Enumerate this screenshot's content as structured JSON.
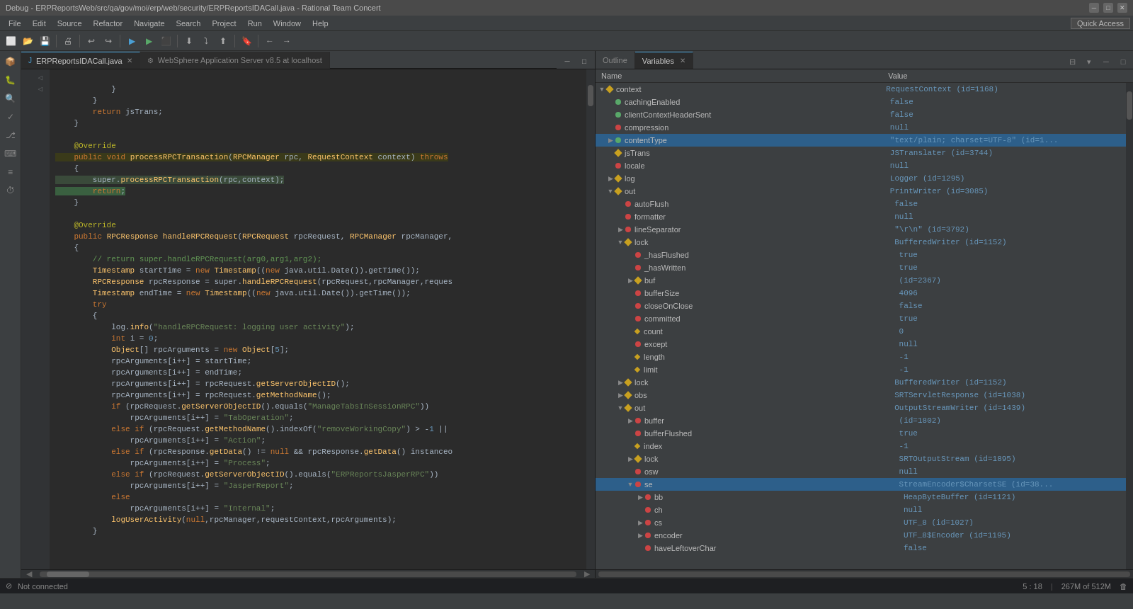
{
  "titleBar": {
    "title": "Debug - ERPReportsWeb/src/qa/gov/moi/erp/web/security/ERPReportsIDACall.java - Rational Team Concert"
  },
  "menuBar": {
    "items": [
      "File",
      "Edit",
      "Source",
      "Refactor",
      "Navigate",
      "Search",
      "Project",
      "Run",
      "Window",
      "Help"
    ]
  },
  "toolbar": {
    "quickAccess": "Quick Access"
  },
  "editorTabs": [
    {
      "label": "ERPReportsIDACall.java",
      "active": true,
      "icon": "J"
    },
    {
      "label": "WebSphere Application Server v8.5 at localhost",
      "active": false,
      "icon": "W"
    }
  ],
  "varsTabs": [
    {
      "label": "Outline",
      "active": false
    },
    {
      "label": "Variables",
      "active": true
    }
  ],
  "varsHeader": {
    "nameCol": "Name",
    "valueCol": "Value"
  },
  "varsRows": [
    {
      "indent": 0,
      "expandable": true,
      "expanded": true,
      "dotType": "diamond",
      "name": "context",
      "value": "RequestContext (id=1168)",
      "selected": false
    },
    {
      "indent": 1,
      "expandable": false,
      "dotType": "green",
      "name": "cachingEnabled",
      "value": "false",
      "selected": false
    },
    {
      "indent": 1,
      "expandable": false,
      "dotType": "green",
      "name": "clientContextHeaderSent",
      "value": "false",
      "selected": false
    },
    {
      "indent": 1,
      "expandable": false,
      "dotType": "red",
      "name": "compression",
      "value": "null",
      "selected": false
    },
    {
      "indent": 1,
      "expandable": true,
      "expanded": false,
      "dotType": "green",
      "name": "contentType",
      "value": "\"text/plain; charset=UTF-8\" (id=1...",
      "selected": true
    },
    {
      "indent": 1,
      "expandable": false,
      "dotType": "diamond",
      "name": "jsTrans",
      "value": "JSTranslater (id=3744)",
      "selected": false
    },
    {
      "indent": 1,
      "expandable": false,
      "dotType": "red",
      "name": "locale",
      "value": "null",
      "selected": false
    },
    {
      "indent": 1,
      "expandable": true,
      "expanded": false,
      "dotType": "diamond",
      "name": "log",
      "value": "Logger (id=1295)",
      "selected": false
    },
    {
      "indent": 1,
      "expandable": true,
      "expanded": true,
      "dotType": "diamond",
      "name": "out",
      "value": "PrintWriter (id=3085)",
      "selected": false
    },
    {
      "indent": 2,
      "expandable": false,
      "dotType": "red",
      "name": "autoFlush",
      "value": "false",
      "selected": false
    },
    {
      "indent": 2,
      "expandable": false,
      "dotType": "red",
      "name": "formatter",
      "value": "null",
      "selected": false
    },
    {
      "indent": 2,
      "expandable": true,
      "expanded": false,
      "dotType": "red",
      "name": "lineSeparator",
      "value": "\"\\r\\n\" (id=3792)",
      "selected": false
    },
    {
      "indent": 2,
      "expandable": true,
      "expanded": true,
      "dotType": "diamond",
      "name": "lock",
      "value": "BufferedWriter (id=1152)",
      "selected": false
    },
    {
      "indent": 3,
      "expandable": false,
      "dotType": "red",
      "name": "_hasFlushed",
      "value": "true",
      "selected": false
    },
    {
      "indent": 3,
      "expandable": false,
      "dotType": "red",
      "name": "_hasWritten",
      "value": "true",
      "selected": false
    },
    {
      "indent": 3,
      "expandable": true,
      "expanded": false,
      "dotType": "diamond",
      "name": "buf",
      "value": "(id=2367)",
      "selected": false
    },
    {
      "indent": 3,
      "expandable": false,
      "dotType": "red",
      "name": "bufferSize",
      "value": "4096",
      "selected": false
    },
    {
      "indent": 3,
      "expandable": false,
      "dotType": "red",
      "name": "closeOnClose",
      "value": "false",
      "selected": false
    },
    {
      "indent": 3,
      "expandable": false,
      "dotType": "red",
      "name": "committed",
      "value": "true",
      "selected": false
    },
    {
      "indent": 3,
      "expandable": false,
      "dotType": "diamond-sm",
      "name": "count",
      "value": "0",
      "selected": false
    },
    {
      "indent": 3,
      "expandable": false,
      "dotType": "red",
      "name": "except",
      "value": "null",
      "selected": false
    },
    {
      "indent": 3,
      "expandable": false,
      "dotType": "diamond-sm",
      "name": "length",
      "value": "-1",
      "selected": false
    },
    {
      "indent": 3,
      "expandable": false,
      "dotType": "diamond-sm",
      "name": "limit",
      "value": "-1",
      "selected": false
    },
    {
      "indent": 2,
      "expandable": true,
      "expanded": false,
      "dotType": "diamond",
      "name": "lock",
      "value": "BufferedWriter (id=1152)",
      "selected": false
    },
    {
      "indent": 2,
      "expandable": true,
      "expanded": false,
      "dotType": "diamond",
      "name": "obs",
      "value": "SRTServletResponse (id=1038)",
      "selected": false
    },
    {
      "indent": 2,
      "expandable": true,
      "expanded": true,
      "dotType": "diamond",
      "name": "out",
      "value": "OutputStreamWriter (id=1439)",
      "selected": false
    },
    {
      "indent": 3,
      "expandable": true,
      "expanded": false,
      "dotType": "red",
      "name": "buffer",
      "value": "(id=1802)",
      "selected": false
    },
    {
      "indent": 3,
      "expandable": false,
      "dotType": "red",
      "name": "bufferFlushed",
      "value": "true",
      "selected": false
    },
    {
      "indent": 3,
      "expandable": false,
      "dotType": "diamond-sm",
      "name": "index",
      "value": "-1",
      "selected": false
    },
    {
      "indent": 3,
      "expandable": true,
      "expanded": false,
      "dotType": "diamond",
      "name": "lock",
      "value": "SRTOutputStream (id=1895)",
      "selected": false
    },
    {
      "indent": 3,
      "expandable": false,
      "dotType": "red",
      "name": "osw",
      "value": "null",
      "selected": false
    },
    {
      "indent": 3,
      "expandable": true,
      "expanded": true,
      "dotType": "red",
      "name": "se",
      "value": "StreamEncoder$CharsetSE (id=38...",
      "selected": true
    },
    {
      "indent": 4,
      "expandable": true,
      "expanded": false,
      "dotType": "red",
      "name": "bb",
      "value": "HeapByteBuffer (id=1121)",
      "selected": false
    },
    {
      "indent": 4,
      "expandable": false,
      "dotType": "red",
      "name": "ch",
      "value": "null",
      "selected": false
    },
    {
      "indent": 4,
      "expandable": true,
      "expanded": false,
      "dotType": "red",
      "name": "cs",
      "value": "UTF_8 (id=1027)",
      "selected": false
    },
    {
      "indent": 4,
      "expandable": true,
      "expanded": false,
      "dotType": "red",
      "name": "encoder",
      "value": "UTF_8$Encoder (id=1195)",
      "selected": false
    },
    {
      "indent": 4,
      "expandable": false,
      "dotType": "red",
      "name": "haveLeftoverChar",
      "value": "false",
      "selected": false
    }
  ],
  "statusBar": {
    "left": "Not connected",
    "position": "5 : 18",
    "memory": "267M of 512M"
  },
  "codeLines": [
    "            }",
    "        }",
    "        return jsTrans;",
    "    }",
    "",
    "    @Override",
    "    public void processRPCTransaction(RPCManager rpc, RequestContext context) throws",
    "    {",
    "        super.processRPCTransaction(rpc,context);",
    "        return;",
    "    }",
    "",
    "    @Override",
    "    public RPCResponse handleRPCRequest(RPCRequest rpcRequest, RPCManager rpcManager,",
    "    {",
    "        // return super.handleRPCRequest(arg0,arg1,arg2);",
    "        Timestamp startTime = new Timestamp((new java.util.Date()).getTime());",
    "        RPCResponse rpcResponse = super.handleRPCRequest(rpcRequest,rpcManager,reques",
    "        Timestamp endTime = new Timestamp((new java.util.Date()).getTime());",
    "        try",
    "        {",
    "            log.info(\"handleRPCRequest: logging user activity\");",
    "            int i = 0;",
    "            Object[] rpcArguments = new Object[5];",
    "            rpcArguments[i++] = startTime;",
    "            rpcArguments[i++] = endTime;",
    "            rpcArguments[i++] = rpcRequest.getServerObjectID();",
    "            rpcArguments[i++] = rpcRequest.getMethodName();",
    "            if (rpcRequest.getServerObjectID().equals(\"ManageTabsInSessionRPC\"))",
    "                rpcArguments[i++] = \"TabOperation\";",
    "            else if (rpcRequest.getMethodName().indexOf(\"removeWorkingCopy\") > -1 ||",
    "                rpcArguments[i++] = \"Action\";",
    "            else if (rpcResponse.getData() != null && rpcResponse.getData() instanceo",
    "                rpcArguments[i++] = \"Process\";",
    "            else if (rpcRequest.getServerObjectID().equals(\"ERPReportsJasperRPC\"))",
    "                rpcArguments[i++] = \"JasperReport\";",
    "            else",
    "                rpcArguments[i++] = \"Internal\";",
    "            logUserActivity(null,rpcManager,requestContext,rpcArguments);",
    "        }"
  ],
  "lineNumbers": [
    "",
    "",
    "",
    "",
    "",
    "",
    "",
    "",
    "",
    "",
    "",
    "",
    "",
    "",
    "",
    "",
    "",
    "",
    "",
    "",
    "",
    "",
    "",
    "",
    "",
    "",
    "",
    "",
    "",
    "",
    "",
    "",
    "",
    "",
    "",
    "",
    "",
    "",
    "",
    ""
  ]
}
